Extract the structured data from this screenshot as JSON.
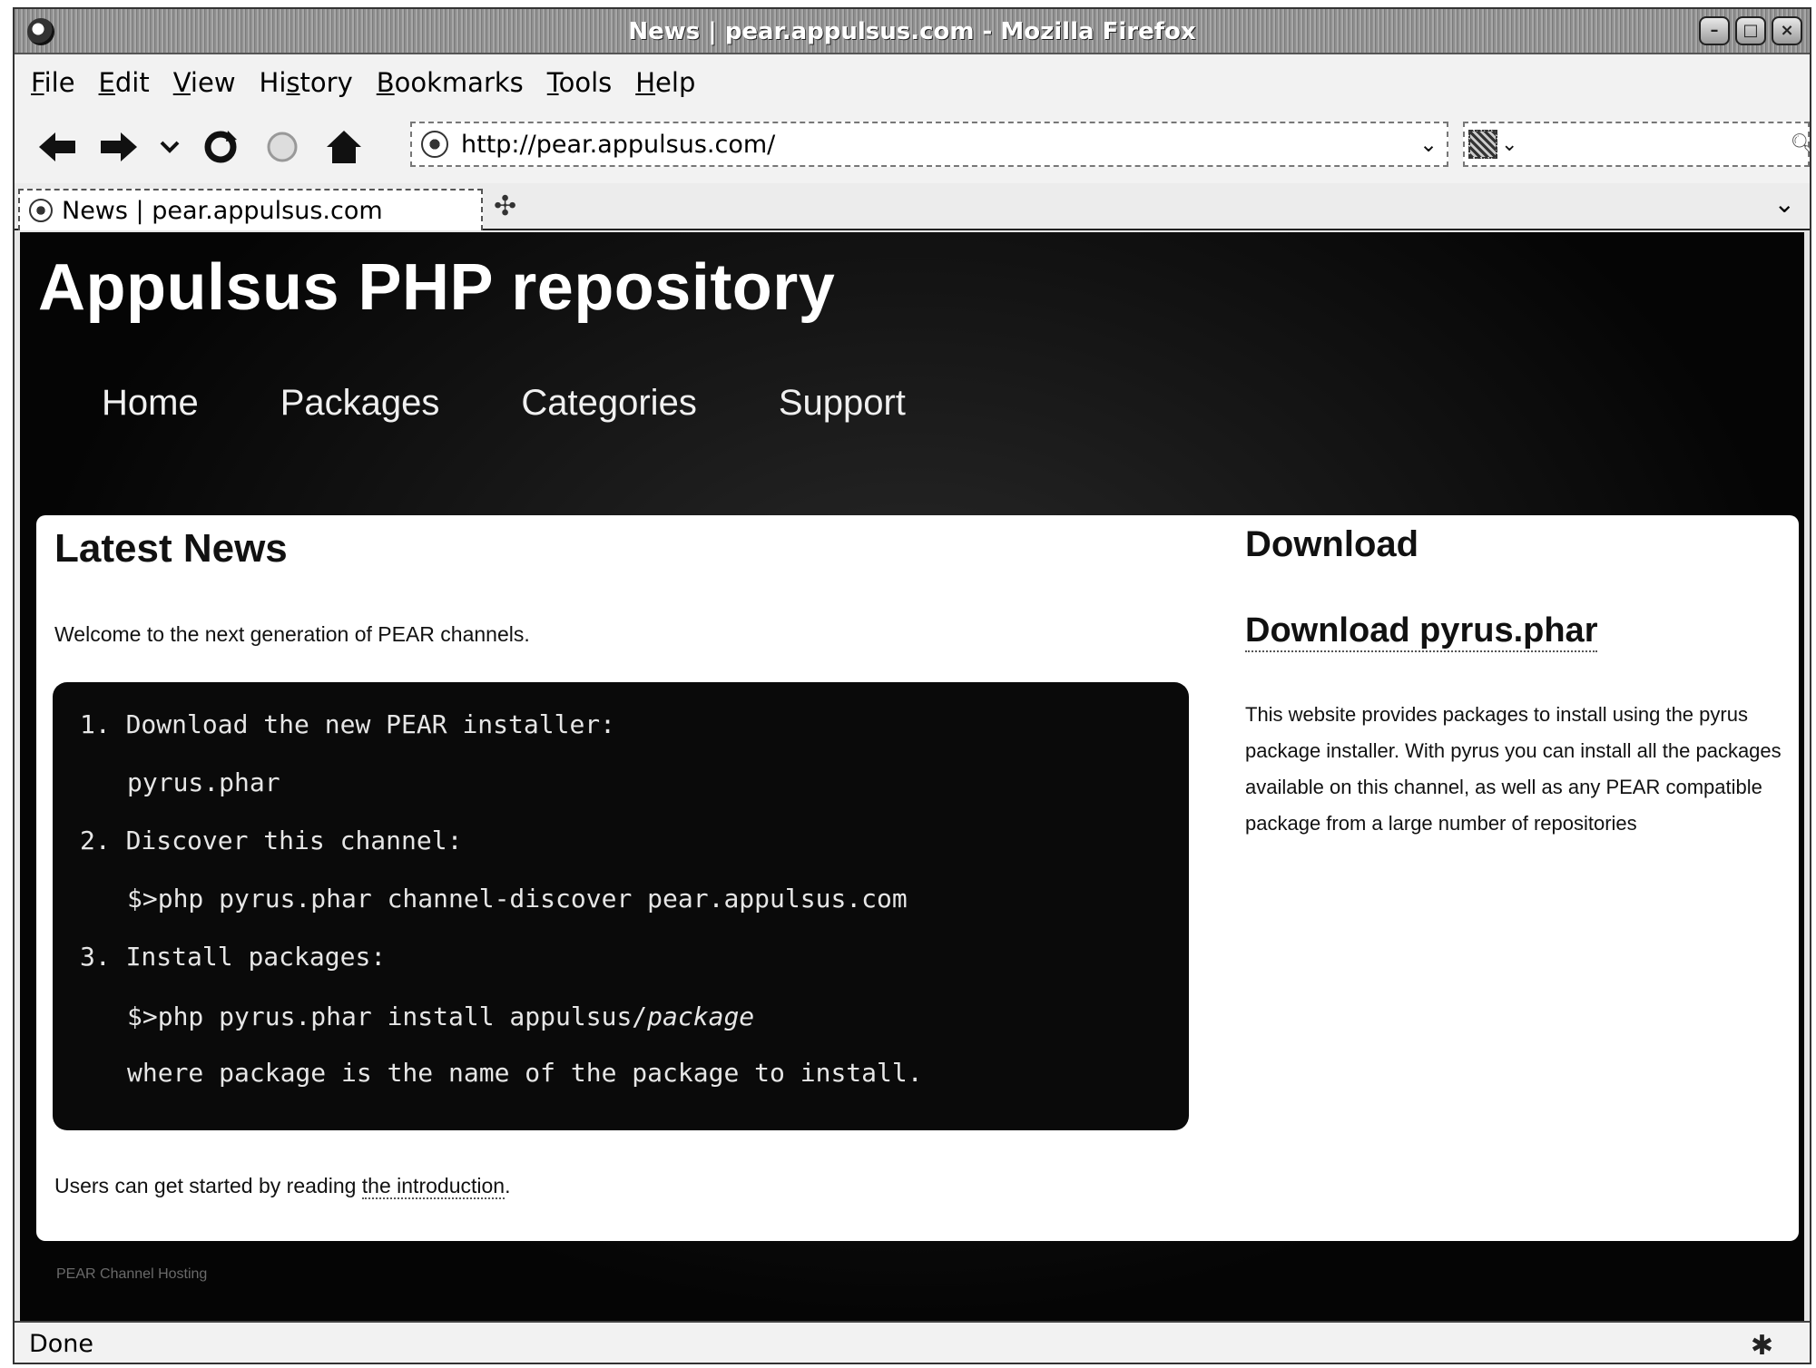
{
  "window": {
    "title": "News | pear.appulsus.com - Mozilla Firefox"
  },
  "menu": [
    {
      "first": "F",
      "rest": "ile"
    },
    {
      "first": "E",
      "rest": "dit"
    },
    {
      "first": "V",
      "rest": "iew"
    },
    {
      "first": "Hi",
      "u": "s",
      "rest": "tory"
    },
    {
      "first": "B",
      "rest": "ookmarks"
    },
    {
      "first": "T",
      "rest": "ools"
    },
    {
      "first": "H",
      "rest": "elp"
    }
  ],
  "address_bar": {
    "url": "http://pear.appulsus.com/"
  },
  "search_bar": {
    "placeholder": ""
  },
  "tab": {
    "label": "News | pear.appulsus.com"
  },
  "site": {
    "title": "Appulsus PHP repository",
    "nav": [
      "Home",
      "Packages",
      "Categories",
      "Support"
    ]
  },
  "news": {
    "heading": "Latest News",
    "welcome": "Welcome to the next generation of PEAR channels.",
    "steps": [
      {
        "num": "1.",
        "text": "Download the new PEAR installer:"
      },
      {
        "sub": "pyrus.phar"
      },
      {
        "num": "2.",
        "text": "Discover this channel:"
      },
      {
        "sub": "$>php pyrus.phar channel-discover pear.appulsus.com"
      },
      {
        "num": "3.",
        "text": "Install packages:"
      },
      {
        "sub_prefix": "$>php pyrus.phar install appulsus/",
        "sub_em": "package"
      },
      {
        "sub": "where package is the name of the package to install."
      }
    ],
    "intro_prefix": "Users can get started by reading ",
    "intro_link": "the introduction",
    "intro_suffix": "."
  },
  "download": {
    "heading": "Download",
    "link": "Download pyrus.phar",
    "description": "This website provides packages to install using the pyrus package installer. With pyrus you can install all the packages available on this channel, as well as any PEAR compatible package from a large number of repositories"
  },
  "footer": {
    "text": "PEAR Channel Hosting"
  },
  "status": {
    "text": "Done"
  }
}
